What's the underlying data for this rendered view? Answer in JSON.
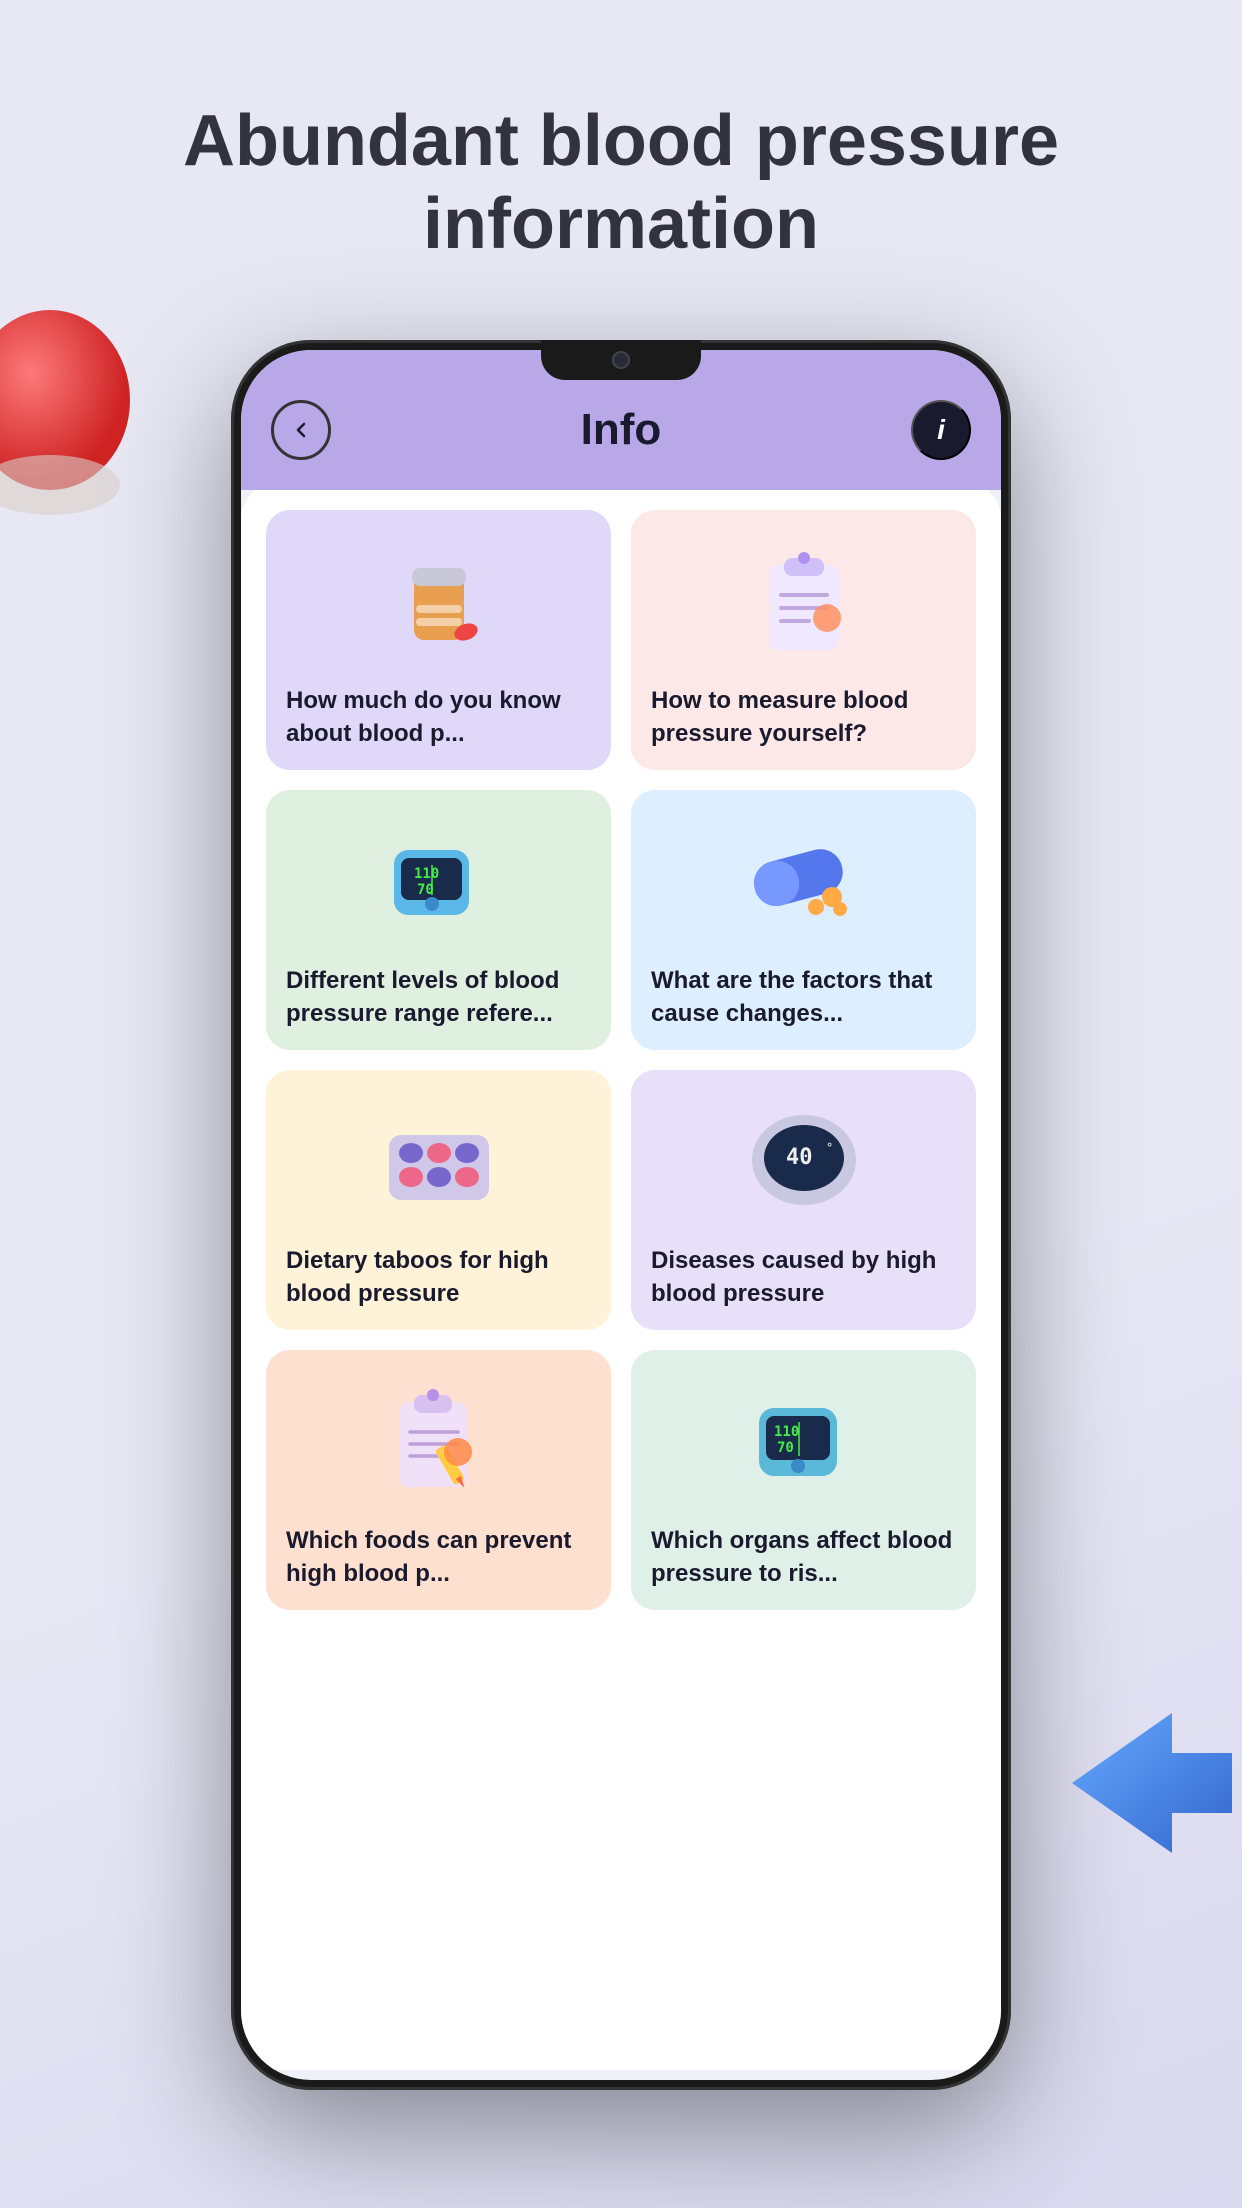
{
  "page": {
    "background_color": "#e8e8f5",
    "title_line1": "Abundant blood pressure",
    "title_line2": "information"
  },
  "header": {
    "title": "Info",
    "back_label": "back",
    "info_label": "i"
  },
  "cards": [
    {
      "id": "card-1",
      "label": "How much do you know about blood p...",
      "color_class": "card-purple",
      "icon": "pill-bottle"
    },
    {
      "id": "card-2",
      "label": "How to measure blood pressure yourself?",
      "color_class": "card-pink",
      "icon": "clipboard"
    },
    {
      "id": "card-3",
      "label": "Different levels of blood pressure range refere...",
      "color_class": "card-green",
      "icon": "bp-monitor"
    },
    {
      "id": "card-4",
      "label": "What are the factors that cause changes...",
      "color_class": "card-blue",
      "icon": "capsule"
    },
    {
      "id": "card-5",
      "label": "Dietary taboos for high blood pressure",
      "color_class": "card-yellow",
      "icon": "pills-blister"
    },
    {
      "id": "card-6",
      "label": "Diseases caused by high blood pressure",
      "color_class": "card-lavender",
      "icon": "thermometer"
    },
    {
      "id": "card-7",
      "label": "Which foods can prevent high blood p...",
      "color_class": "card-peach",
      "icon": "clipboard2"
    },
    {
      "id": "card-8",
      "label": "Which organs affect blood pressure to ris...",
      "color_class": "card-mint",
      "icon": "bp-monitor2"
    }
  ]
}
